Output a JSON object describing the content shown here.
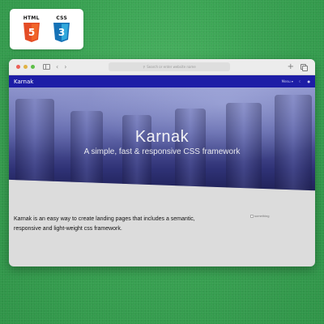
{
  "badges": [
    {
      "label": "HTML",
      "number": "5",
      "color": "#e44d26",
      "icon": "html5-icon"
    },
    {
      "label": "CSS",
      "number": "3",
      "color": "#1572b6",
      "icon": "css3-icon"
    }
  ],
  "browser": {
    "address_placeholder": "Search or enter website name",
    "nav_back_icon": "chevron-left-icon",
    "nav_forward_icon": "chevron-right-icon",
    "new_tab_icon": "plus-icon",
    "tabs_icon": "tabs-overview-icon"
  },
  "site": {
    "brand": "Karnak",
    "nav": {
      "menu_label": "Menu",
      "icons": [
        "chevron-down-icon",
        "moon-icon",
        "github-icon"
      ]
    },
    "colors": {
      "navbar": "#1d1da6"
    },
    "hero": {
      "title": "Karnak",
      "subtitle": "A simple, fast & responsive CSS framework"
    },
    "intro": "Karnak is an easy way to create landing pages that includes a semantic, responsive and light-weight css framework.",
    "image_alt": "something"
  }
}
